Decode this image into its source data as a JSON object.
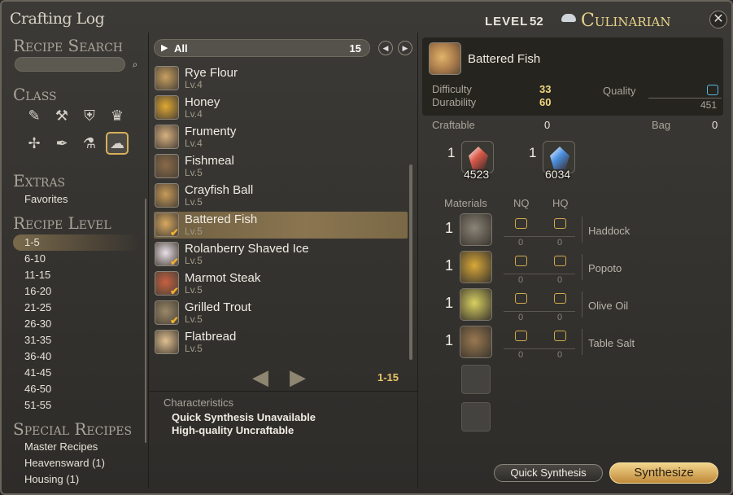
{
  "window": {
    "title": "Crafting Log",
    "level_label": "LEVEL",
    "level_value": "52",
    "job": "Culinarian",
    "close_glyph": "✕"
  },
  "left": {
    "recipe_search": "Recipe Search",
    "search_placeholder": "",
    "class_heading": "Class",
    "classes": [
      {
        "icon": "carpenter-icon",
        "glyph": "✎"
      },
      {
        "icon": "blacksmith-icon",
        "glyph": "⚒"
      },
      {
        "icon": "armorer-icon",
        "glyph": "⛨"
      },
      {
        "icon": "goldsmith-icon",
        "glyph": "♛"
      },
      {
        "icon": "leatherworker-icon",
        "glyph": "✢"
      },
      {
        "icon": "weaver-icon",
        "glyph": "✒"
      },
      {
        "icon": "alchemist-icon",
        "glyph": "⚗"
      },
      {
        "icon": "culinarian-icon",
        "glyph": "☁"
      }
    ],
    "extras_heading": "Extras",
    "favorites": "Favorites",
    "recipe_level_heading": "Recipe Level",
    "levels": [
      "1-5",
      "6-10",
      "11-15",
      "16-20",
      "21-25",
      "26-30",
      "31-35",
      "36-40",
      "41-45",
      "46-50",
      "51-55"
    ],
    "special_heading": "Special Recipes",
    "special": [
      "Master Recipes",
      "Heavensward (1)",
      "Housing (1)"
    ]
  },
  "middle": {
    "filter_label": "All",
    "filter_count": "15",
    "prev_glyph": "◀",
    "next_glyph": "▶",
    "recipes": [
      {
        "name": "Rye Flour",
        "level": "Lv.4",
        "checked": false,
        "color": "#c8a060"
      },
      {
        "name": "Honey",
        "level": "Lv.4",
        "checked": false,
        "color": "#e0a830"
      },
      {
        "name": "Frumenty",
        "level": "Lv.4",
        "checked": false,
        "color": "#d8b080"
      },
      {
        "name": "Fishmeal",
        "level": "Lv.5",
        "checked": false,
        "color": "#8a6a48"
      },
      {
        "name": "Crayfish Ball",
        "level": "Lv.5",
        "checked": false,
        "color": "#c89a58"
      },
      {
        "name": "Battered Fish",
        "level": "Lv.5",
        "checked": true,
        "color": "#d8a860"
      },
      {
        "name": "Rolanberry Shaved Ice",
        "level": "Lv.5",
        "checked": true,
        "color": "#e8e0e8"
      },
      {
        "name": "Marmot Steak",
        "level": "Lv.5",
        "checked": true,
        "color": "#c86040"
      },
      {
        "name": "Grilled Trout",
        "level": "Lv.5",
        "checked": true,
        "color": "#9a8868"
      },
      {
        "name": "Flatbread",
        "level": "Lv.5",
        "checked": false,
        "color": "#e0c090"
      }
    ],
    "page_range": "1-15",
    "page_prev_glyph": "◀",
    "page_next_glyph": "▶",
    "characteristics_title": "Characteristics",
    "characteristics": [
      "Quick Synthesis Unavailable",
      "High-quality Uncraftable"
    ]
  },
  "right": {
    "item_name": "Battered Fish",
    "difficulty_label": "Difficulty",
    "difficulty": "33",
    "durability_label": "Durability",
    "durability": "60",
    "quality_label": "Quality",
    "quality_max": "451",
    "craftable_label": "Craftable",
    "craftable": "0",
    "bag_label": "Bag",
    "bag": "0",
    "crystals": [
      {
        "qty": "1",
        "count": "4523",
        "color": "#d85848",
        "icon": "fire-crystal-icon"
      },
      {
        "qty": "1",
        "count": "6034",
        "color": "#4a90e0",
        "icon": "water-crystal-icon"
      }
    ],
    "materials_label": "Materials",
    "nq_label": "NQ",
    "hq_label": "HQ",
    "materials": [
      {
        "qty": "1",
        "name": "Haddock",
        "nq": "0",
        "hq": "0",
        "color": "#8a8478",
        "icon": "haddock-icon"
      },
      {
        "qty": "1",
        "name": "Popoto",
        "nq": "0",
        "hq": "0",
        "color": "#d8a838",
        "icon": "popoto-icon"
      },
      {
        "qty": "1",
        "name": "Olive Oil",
        "nq": "0",
        "hq": "0",
        "color": "#d8d060",
        "icon": "olive-oil-icon"
      },
      {
        "qty": "1",
        "name": "Table Salt",
        "nq": "0",
        "hq": "0",
        "color": "#9a7850",
        "icon": "table-salt-icon"
      }
    ],
    "quick_synthesis": "Quick Synthesis",
    "synthesize": "Synthesize"
  }
}
